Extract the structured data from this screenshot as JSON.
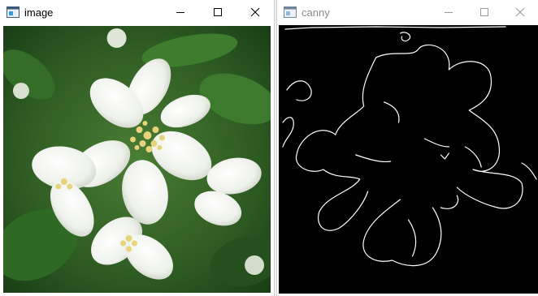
{
  "windows": [
    {
      "title": "image",
      "active": true,
      "controls": {
        "minimize_icon": "minimize-icon",
        "maximize_icon": "maximize-icon",
        "close_icon": "close-icon"
      }
    },
    {
      "title": "canny",
      "active": false,
      "controls": {
        "minimize_icon": "minimize-icon",
        "maximize_icon": "maximize-icon",
        "close_icon": "close-icon"
      }
    }
  ],
  "colors": {
    "titlebar_bg": "#ffffff",
    "title_active": "#000000",
    "title_inactive": "#8a8a8a",
    "leaf_green_dark": "#1f4a1a",
    "leaf_green": "#3f7a2c",
    "petal_white": "#f4f6f0",
    "stamen_yellow": "#e3d27a",
    "canny_bg": "#000000",
    "canny_edge": "#ffffff"
  }
}
